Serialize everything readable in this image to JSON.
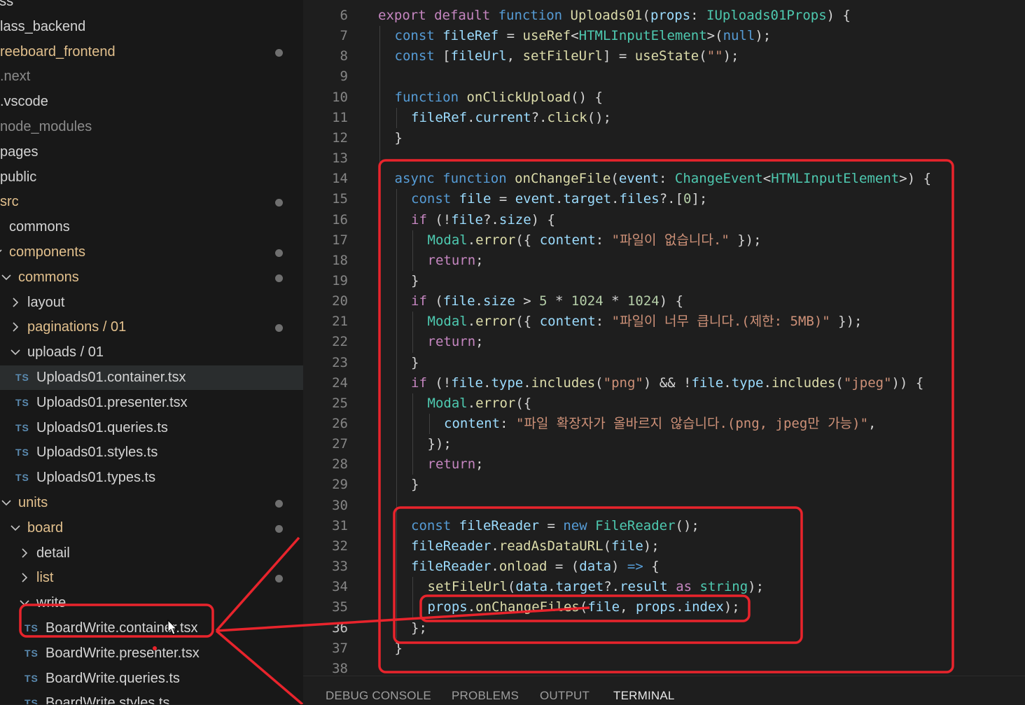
{
  "sidebar": {
    "items": [
      {
        "label": "ass",
        "color": "white",
        "indent": -12,
        "chevron": "none",
        "dot": false
      },
      {
        "label": "lass_backend",
        "color": "white",
        "indent": 0,
        "chevron": "none",
        "dot": false
      },
      {
        "label": "reeboard_frontend",
        "color": "gold",
        "indent": 0,
        "chevron": "none",
        "dot": true
      },
      {
        "label": ".next",
        "color": "gray",
        "indent": 0,
        "chevron": "none",
        "dot": false
      },
      {
        "label": ".vscode",
        "color": "white",
        "indent": 0,
        "chevron": "none",
        "dot": false
      },
      {
        "label": "node_modules",
        "color": "gray",
        "indent": 0,
        "chevron": "none",
        "dot": false
      },
      {
        "label": "pages",
        "color": "white",
        "indent": 0,
        "chevron": "none",
        "dot": false
      },
      {
        "label": "public",
        "color": "white",
        "indent": 0,
        "chevron": "none",
        "dot": false
      },
      {
        "label": "src",
        "color": "gold",
        "indent": 0,
        "chevron": "none",
        "dot": true
      },
      {
        "label": "commons",
        "color": "white",
        "indent": 13,
        "chevron": "none",
        "dot": false
      },
      {
        "label": "components",
        "color": "gold",
        "indent": 13,
        "chevron": "down-partial",
        "dot": true
      },
      {
        "label": "commons",
        "color": "gold",
        "indent": 26,
        "chevron": "down",
        "dot": true
      },
      {
        "label": "layout",
        "color": "white",
        "indent": 39,
        "chevron": "right",
        "dot": false
      },
      {
        "label": "paginations / 01",
        "color": "gold",
        "indent": 39,
        "chevron": "right",
        "dot": true
      },
      {
        "label": "uploads / 01",
        "color": "white",
        "indent": 39,
        "chevron": "down",
        "dot": false
      },
      {
        "label": "Uploads01.container.tsx",
        "color": "white",
        "indent": 52,
        "chevron": "none",
        "ts": true,
        "selected": true,
        "dot": false
      },
      {
        "label": "Uploads01.presenter.tsx",
        "color": "white",
        "indent": 52,
        "chevron": "none",
        "ts": true,
        "dot": false
      },
      {
        "label": "Uploads01.queries.ts",
        "color": "white",
        "indent": 52,
        "chevron": "none",
        "ts": true,
        "dot": false
      },
      {
        "label": "Uploads01.styles.ts",
        "color": "white",
        "indent": 52,
        "chevron": "none",
        "ts": true,
        "dot": false
      },
      {
        "label": "Uploads01.types.ts",
        "color": "white",
        "indent": 52,
        "chevron": "none",
        "ts": true,
        "dot": false
      },
      {
        "label": "units",
        "color": "gold",
        "indent": 26,
        "chevron": "down",
        "dot": true
      },
      {
        "label": "board",
        "color": "gold",
        "indent": 39,
        "chevron": "down",
        "dot": true
      },
      {
        "label": "detail",
        "color": "white",
        "indent": 52,
        "chevron": "right",
        "dot": false
      },
      {
        "label": "list",
        "color": "gold",
        "indent": 52,
        "chevron": "right",
        "dot": true
      },
      {
        "label": "write",
        "color": "white",
        "indent": 52,
        "chevron": "down",
        "dot": false
      },
      {
        "label": "BoardWrite.container.tsx",
        "color": "white",
        "indent": 65,
        "chevron": "none",
        "ts": true,
        "dot": false
      },
      {
        "label": "BoardWrite.presenter.tsx",
        "color": "white",
        "indent": 65,
        "chevron": "none",
        "ts": true,
        "dot": false
      },
      {
        "label": "BoardWrite.queries.ts",
        "color": "white",
        "indent": 65,
        "chevron": "none",
        "ts": true,
        "dot": false
      },
      {
        "label": "BoardWrite.styles.ts",
        "color": "white",
        "indent": 65,
        "chevron": "none",
        "ts": true,
        "dot": false
      }
    ],
    "ts_badge": "TS"
  },
  "colors": {
    "sidebar_white": "#d4d4d4",
    "sidebar_gold": "#e2c08d",
    "sidebar_gray": "#8b8b8b",
    "annotation_red": "#e8242c",
    "keyword": "#569cd6",
    "control": "#c586c0",
    "function": "#dcdcaa",
    "variable": "#9cdcfe",
    "type": "#4ec9b0",
    "string": "#ce9178",
    "number": "#b5cea8",
    "plain": "#d4d4d4"
  },
  "editor": {
    "active_line": 36,
    "lines": [
      {
        "n": 6,
        "indent": 0,
        "tokens": [
          [
            "export ",
            "control"
          ],
          [
            "default ",
            "control"
          ],
          [
            "function ",
            "keyword"
          ],
          [
            "Uploads01",
            "function"
          ],
          [
            "(",
            "plain"
          ],
          [
            "props",
            "variable"
          ],
          [
            ": ",
            "plain"
          ],
          [
            "IUploads01Props",
            "type"
          ],
          [
            ") {",
            "plain"
          ]
        ]
      },
      {
        "n": 7,
        "indent": 1,
        "tokens": [
          [
            "const ",
            "keyword"
          ],
          [
            "fileRef",
            "variable"
          ],
          [
            " = ",
            "plain"
          ],
          [
            "useRef",
            "function"
          ],
          [
            "<",
            "plain"
          ],
          [
            "HTMLInputElement",
            "type"
          ],
          [
            ">(",
            "plain"
          ],
          [
            "null",
            "keyword"
          ],
          [
            ");",
            "plain"
          ]
        ]
      },
      {
        "n": 8,
        "indent": 1,
        "tokens": [
          [
            "const ",
            "keyword"
          ],
          [
            "[",
            "plain"
          ],
          [
            "fileUrl",
            "variable"
          ],
          [
            ", ",
            "plain"
          ],
          [
            "setFileUrl",
            "function"
          ],
          [
            "] = ",
            "plain"
          ],
          [
            "useState",
            "function"
          ],
          [
            "(",
            "plain"
          ],
          [
            "\"\"",
            "string"
          ],
          [
            ");",
            "plain"
          ]
        ]
      },
      {
        "n": 9,
        "indent": 0,
        "tokens": []
      },
      {
        "n": 10,
        "indent": 1,
        "tokens": [
          [
            "function ",
            "keyword"
          ],
          [
            "onClickUpload",
            "function"
          ],
          [
            "() {",
            "plain"
          ]
        ]
      },
      {
        "n": 11,
        "indent": 2,
        "tokens": [
          [
            "fileRef",
            "variable"
          ],
          [
            ".",
            "plain"
          ],
          [
            "current",
            "variable"
          ],
          [
            "?.",
            "plain"
          ],
          [
            "click",
            "function"
          ],
          [
            "();",
            "plain"
          ]
        ]
      },
      {
        "n": 12,
        "indent": 1,
        "tokens": [
          [
            "}",
            "plain"
          ]
        ]
      },
      {
        "n": 13,
        "indent": 0,
        "tokens": []
      },
      {
        "n": 14,
        "indent": 1,
        "tokens": [
          [
            "async ",
            "keyword"
          ],
          [
            "function ",
            "keyword"
          ],
          [
            "onChangeFile",
            "function"
          ],
          [
            "(",
            "plain"
          ],
          [
            "event",
            "variable"
          ],
          [
            ": ",
            "plain"
          ],
          [
            "ChangeEvent",
            "type"
          ],
          [
            "<",
            "plain"
          ],
          [
            "HTMLInputElement",
            "type"
          ],
          [
            ">) {",
            "plain"
          ]
        ]
      },
      {
        "n": 15,
        "indent": 2,
        "tokens": [
          [
            "const ",
            "keyword"
          ],
          [
            "file",
            "variable"
          ],
          [
            " = ",
            "plain"
          ],
          [
            "event",
            "variable"
          ],
          [
            ".",
            "plain"
          ],
          [
            "target",
            "variable"
          ],
          [
            ".",
            "plain"
          ],
          [
            "files",
            "variable"
          ],
          [
            "?.[",
            "plain"
          ],
          [
            "0",
            "number"
          ],
          [
            "];",
            "plain"
          ]
        ]
      },
      {
        "n": 16,
        "indent": 2,
        "tokens": [
          [
            "if ",
            "control"
          ],
          [
            "(!",
            "plain"
          ],
          [
            "file",
            "variable"
          ],
          [
            "?.",
            "plain"
          ],
          [
            "size",
            "variable"
          ],
          [
            ") {",
            "plain"
          ]
        ]
      },
      {
        "n": 17,
        "indent": 3,
        "tokens": [
          [
            "Modal",
            "type"
          ],
          [
            ".",
            "plain"
          ],
          [
            "error",
            "function"
          ],
          [
            "({ ",
            "plain"
          ],
          [
            "content",
            "variable"
          ],
          [
            ": ",
            "plain"
          ],
          [
            "\"파일이 없습니다.\"",
            "string"
          ],
          [
            " });",
            "plain"
          ]
        ]
      },
      {
        "n": 18,
        "indent": 3,
        "tokens": [
          [
            "return",
            "control"
          ],
          [
            ";",
            "plain"
          ]
        ]
      },
      {
        "n": 19,
        "indent": 2,
        "tokens": [
          [
            "}",
            "plain"
          ]
        ]
      },
      {
        "n": 20,
        "indent": 2,
        "tokens": [
          [
            "if ",
            "control"
          ],
          [
            "(",
            "plain"
          ],
          [
            "file",
            "variable"
          ],
          [
            ".",
            "plain"
          ],
          [
            "size",
            "variable"
          ],
          [
            " > ",
            "plain"
          ],
          [
            "5",
            "number"
          ],
          [
            " * ",
            "plain"
          ],
          [
            "1024",
            "number"
          ],
          [
            " * ",
            "plain"
          ],
          [
            "1024",
            "number"
          ],
          [
            ") {",
            "plain"
          ]
        ]
      },
      {
        "n": 21,
        "indent": 3,
        "tokens": [
          [
            "Modal",
            "type"
          ],
          [
            ".",
            "plain"
          ],
          [
            "error",
            "function"
          ],
          [
            "({ ",
            "plain"
          ],
          [
            "content",
            "variable"
          ],
          [
            ": ",
            "plain"
          ],
          [
            "\"파일이 너무 큽니다.(제한: 5MB)\"",
            "string"
          ],
          [
            " });",
            "plain"
          ]
        ]
      },
      {
        "n": 22,
        "indent": 3,
        "tokens": [
          [
            "return",
            "control"
          ],
          [
            ";",
            "plain"
          ]
        ]
      },
      {
        "n": 23,
        "indent": 2,
        "tokens": [
          [
            "}",
            "plain"
          ]
        ]
      },
      {
        "n": 24,
        "indent": 2,
        "tokens": [
          [
            "if ",
            "control"
          ],
          [
            "(!",
            "plain"
          ],
          [
            "file",
            "variable"
          ],
          [
            ".",
            "plain"
          ],
          [
            "type",
            "variable"
          ],
          [
            ".",
            "plain"
          ],
          [
            "includes",
            "function"
          ],
          [
            "(",
            "plain"
          ],
          [
            "\"png\"",
            "string"
          ],
          [
            ") && !",
            "plain"
          ],
          [
            "file",
            "variable"
          ],
          [
            ".",
            "plain"
          ],
          [
            "type",
            "variable"
          ],
          [
            ".",
            "plain"
          ],
          [
            "includes",
            "function"
          ],
          [
            "(",
            "plain"
          ],
          [
            "\"jpeg\"",
            "string"
          ],
          [
            ")) {",
            "plain"
          ]
        ]
      },
      {
        "n": 25,
        "indent": 3,
        "tokens": [
          [
            "Modal",
            "type"
          ],
          [
            ".",
            "plain"
          ],
          [
            "error",
            "function"
          ],
          [
            "({",
            "plain"
          ]
        ]
      },
      {
        "n": 26,
        "indent": 4,
        "tokens": [
          [
            "content",
            "variable"
          ],
          [
            ": ",
            "plain"
          ],
          [
            "\"파일 확장자가 올바르지 않습니다.(png, jpeg만 가능)\"",
            "string"
          ],
          [
            ",",
            "plain"
          ]
        ]
      },
      {
        "n": 27,
        "indent": 3,
        "tokens": [
          [
            "});",
            "plain"
          ]
        ]
      },
      {
        "n": 28,
        "indent": 3,
        "tokens": [
          [
            "return",
            "control"
          ],
          [
            ";",
            "plain"
          ]
        ]
      },
      {
        "n": 29,
        "indent": 2,
        "tokens": [
          [
            "}",
            "plain"
          ]
        ]
      },
      {
        "n": 30,
        "indent": 0,
        "tokens": []
      },
      {
        "n": 31,
        "indent": 2,
        "tokens": [
          [
            "const ",
            "keyword"
          ],
          [
            "fileReader",
            "variable"
          ],
          [
            " = ",
            "plain"
          ],
          [
            "new ",
            "keyword"
          ],
          [
            "FileReader",
            "type"
          ],
          [
            "();",
            "plain"
          ]
        ]
      },
      {
        "n": 32,
        "indent": 2,
        "tokens": [
          [
            "fileReader",
            "variable"
          ],
          [
            ".",
            "plain"
          ],
          [
            "readAsDataURL",
            "function"
          ],
          [
            "(",
            "plain"
          ],
          [
            "file",
            "variable"
          ],
          [
            ");",
            "plain"
          ]
        ]
      },
      {
        "n": 33,
        "indent": 2,
        "tokens": [
          [
            "fileReader",
            "variable"
          ],
          [
            ".",
            "plain"
          ],
          [
            "onload",
            "function"
          ],
          [
            " = (",
            "plain"
          ],
          [
            "data",
            "variable"
          ],
          [
            ") ",
            "plain"
          ],
          [
            "=>",
            "keyword"
          ],
          [
            " {",
            "plain"
          ]
        ]
      },
      {
        "n": 34,
        "indent": 3,
        "tokens": [
          [
            "setFileUrl",
            "function"
          ],
          [
            "(",
            "plain"
          ],
          [
            "data",
            "variable"
          ],
          [
            ".",
            "plain"
          ],
          [
            "target",
            "variable"
          ],
          [
            "?.",
            "plain"
          ],
          [
            "result",
            "variable"
          ],
          [
            " ",
            "plain"
          ],
          [
            "as ",
            "control"
          ],
          [
            "string",
            "type"
          ],
          [
            ");",
            "plain"
          ]
        ]
      },
      {
        "n": 35,
        "indent": 3,
        "tokens": [
          [
            "props",
            "variable"
          ],
          [
            ".",
            "plain"
          ],
          [
            "onChangeFiles",
            "function"
          ],
          [
            "(",
            "plain"
          ],
          [
            "file",
            "variable"
          ],
          [
            ", ",
            "plain"
          ],
          [
            "props",
            "variable"
          ],
          [
            ".",
            "plain"
          ],
          [
            "index",
            "variable"
          ],
          [
            ");",
            "plain"
          ]
        ]
      },
      {
        "n": 36,
        "indent": 2,
        "tokens": [
          [
            "};",
            "plain"
          ]
        ]
      },
      {
        "n": 37,
        "indent": 1,
        "tokens": [
          [
            "}",
            "plain"
          ]
        ]
      },
      {
        "n": 38,
        "indent": 0,
        "tokens": []
      }
    ]
  },
  "panel": {
    "tabs": [
      {
        "label": "DEBUG CONSOLE",
        "active": false
      },
      {
        "label": "PROBLEMS",
        "active": false
      },
      {
        "label": "OUTPUT",
        "active": false
      },
      {
        "label": "TERMINAL",
        "active": true
      }
    ]
  },
  "icons": {
    "chevron_right": "chevron-right-icon",
    "chevron_down": "chevron-down-icon",
    "modified_dot": "modified-dot-icon",
    "mouse_cursor": "mouse-cursor-icon"
  }
}
